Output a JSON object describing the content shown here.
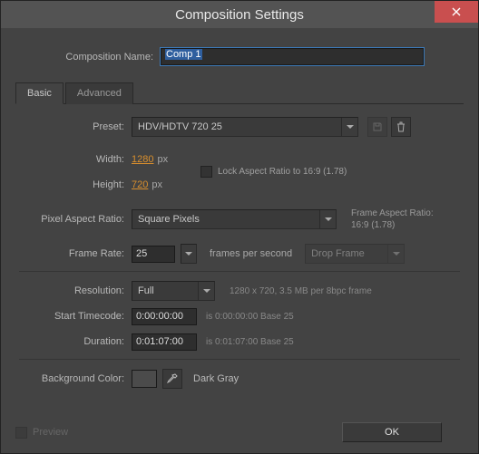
{
  "titlebar": {
    "title": "Composition Settings"
  },
  "name": {
    "label": "Composition Name:",
    "value": "Comp 1"
  },
  "tabs": {
    "basic": "Basic",
    "advanced": "Advanced"
  },
  "preset": {
    "label": "Preset:",
    "value": "HDV/HDTV 720 25"
  },
  "width": {
    "label": "Width:",
    "value": "1280",
    "unit": "px"
  },
  "height": {
    "label": "Height:",
    "value": "720",
    "unit": "px"
  },
  "lock_aspect": {
    "label": "Lock Aspect Ratio to 16:9 (1.78)"
  },
  "par": {
    "label": "Pixel Aspect Ratio:",
    "value": "Square Pixels",
    "side_label": "Frame Aspect Ratio:",
    "side_value": "16:9 (1.78)"
  },
  "frame_rate": {
    "label": "Frame Rate:",
    "value": "25",
    "unit": "frames per second",
    "drop": "Drop Frame"
  },
  "resolution": {
    "label": "Resolution:",
    "value": "Full",
    "caption": "1280 x 720, 3.5 MB per 8bpc frame"
  },
  "start_tc": {
    "label": "Start Timecode:",
    "value": "0:00:00:00",
    "caption": "is 0:00:00:00  Base 25"
  },
  "duration": {
    "label": "Duration:",
    "value": "0:01:07:00",
    "caption": "is 0:01:07:00  Base 25"
  },
  "bg": {
    "label": "Background Color:",
    "name": "Dark Gray",
    "hex": "#4b4b4b"
  },
  "footer": {
    "preview": "Preview",
    "ok": "OK"
  }
}
